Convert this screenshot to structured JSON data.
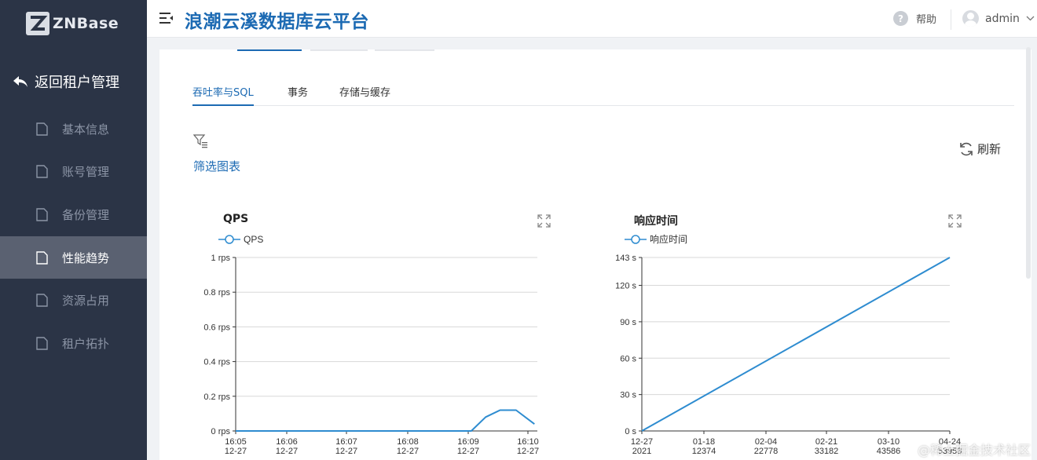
{
  "logo": {
    "text": "ZNBase"
  },
  "sidebar": {
    "back_label": "返回租户管理",
    "items": [
      {
        "label": "基本信息",
        "active": false
      },
      {
        "label": "账号管理",
        "active": false
      },
      {
        "label": "备份管理",
        "active": false
      },
      {
        "label": "性能趋势",
        "active": true
      },
      {
        "label": "资源占用",
        "active": false
      },
      {
        "label": "租户拓扑",
        "active": false
      }
    ]
  },
  "header": {
    "title": "浪潮云溪数据库云平台",
    "help_label": "帮助",
    "user_name": "admin"
  },
  "tabs": [
    "吞吐率与SQL",
    "事务",
    "存储与缓存"
  ],
  "filter_label": "筛选图表",
  "refresh_label": "刷新",
  "charts": {
    "qps": {
      "title": "QPS"
    },
    "resp": {
      "title": "响应时间"
    }
  },
  "chart_data": [
    {
      "type": "line",
      "title": "QPS",
      "series": [
        {
          "name": "QPS",
          "color": "#2e8cd0"
        }
      ],
      "y_ticks": [
        "0 rps",
        "0.2 rps",
        "0.4 rps",
        "0.6 rps",
        "0.8 rps",
        "1 rps"
      ],
      "ylim": [
        0,
        1
      ],
      "x_ticks": [
        {
          "line1": "16:05",
          "line2": "12-27"
        },
        {
          "line1": "16:06",
          "line2": "12-27"
        },
        {
          "line1": "16:07",
          "line2": "12-27"
        },
        {
          "line1": "16:08",
          "line2": "12-27"
        },
        {
          "line1": "16:09",
          "line2": "12-27"
        },
        {
          "line1": "16:10",
          "line2": "12-27"
        }
      ],
      "x_range_minutes": [
        0,
        5.25
      ],
      "points": [
        [
          0,
          0
        ],
        [
          4.1,
          0
        ],
        [
          4.35,
          0.08
        ],
        [
          4.6,
          0.12
        ],
        [
          4.88,
          0.12
        ],
        [
          5.2,
          0.04
        ]
      ],
      "grid": true,
      "legend": "top-left"
    },
    {
      "type": "line",
      "title": "响应时间",
      "series": [
        {
          "name": "响应时间",
          "color": "#2e8cd0"
        }
      ],
      "y_ticks": [
        "0 s",
        "30 s",
        "60 s",
        "90 s",
        "120 s",
        "143 s"
      ],
      "y_tick_values": [
        0,
        30,
        60,
        90,
        120,
        143
      ],
      "ylim": [
        0,
        143
      ],
      "x_ticks": [
        {
          "line1": "12-27",
          "line2": "2021"
        },
        {
          "line1": "01-18",
          "line2": "12374"
        },
        {
          "line1": "02-04",
          "line2": "22778"
        },
        {
          "line1": "02-21",
          "line2": "33182"
        },
        {
          "line1": "03-10",
          "line2": "43586"
        },
        {
          "line1": "04-24",
          "line2": "53958"
        }
      ],
      "points": [
        [
          0,
          0
        ],
        [
          1,
          143
        ]
      ],
      "grid": true,
      "legend": "top-left"
    }
  ],
  "watermark": "@稀土掘金技术社区",
  "colors": {
    "sidebar_bg": "#2b3446",
    "accent": "#1c6ab3",
    "line": "#2e8cd0"
  }
}
